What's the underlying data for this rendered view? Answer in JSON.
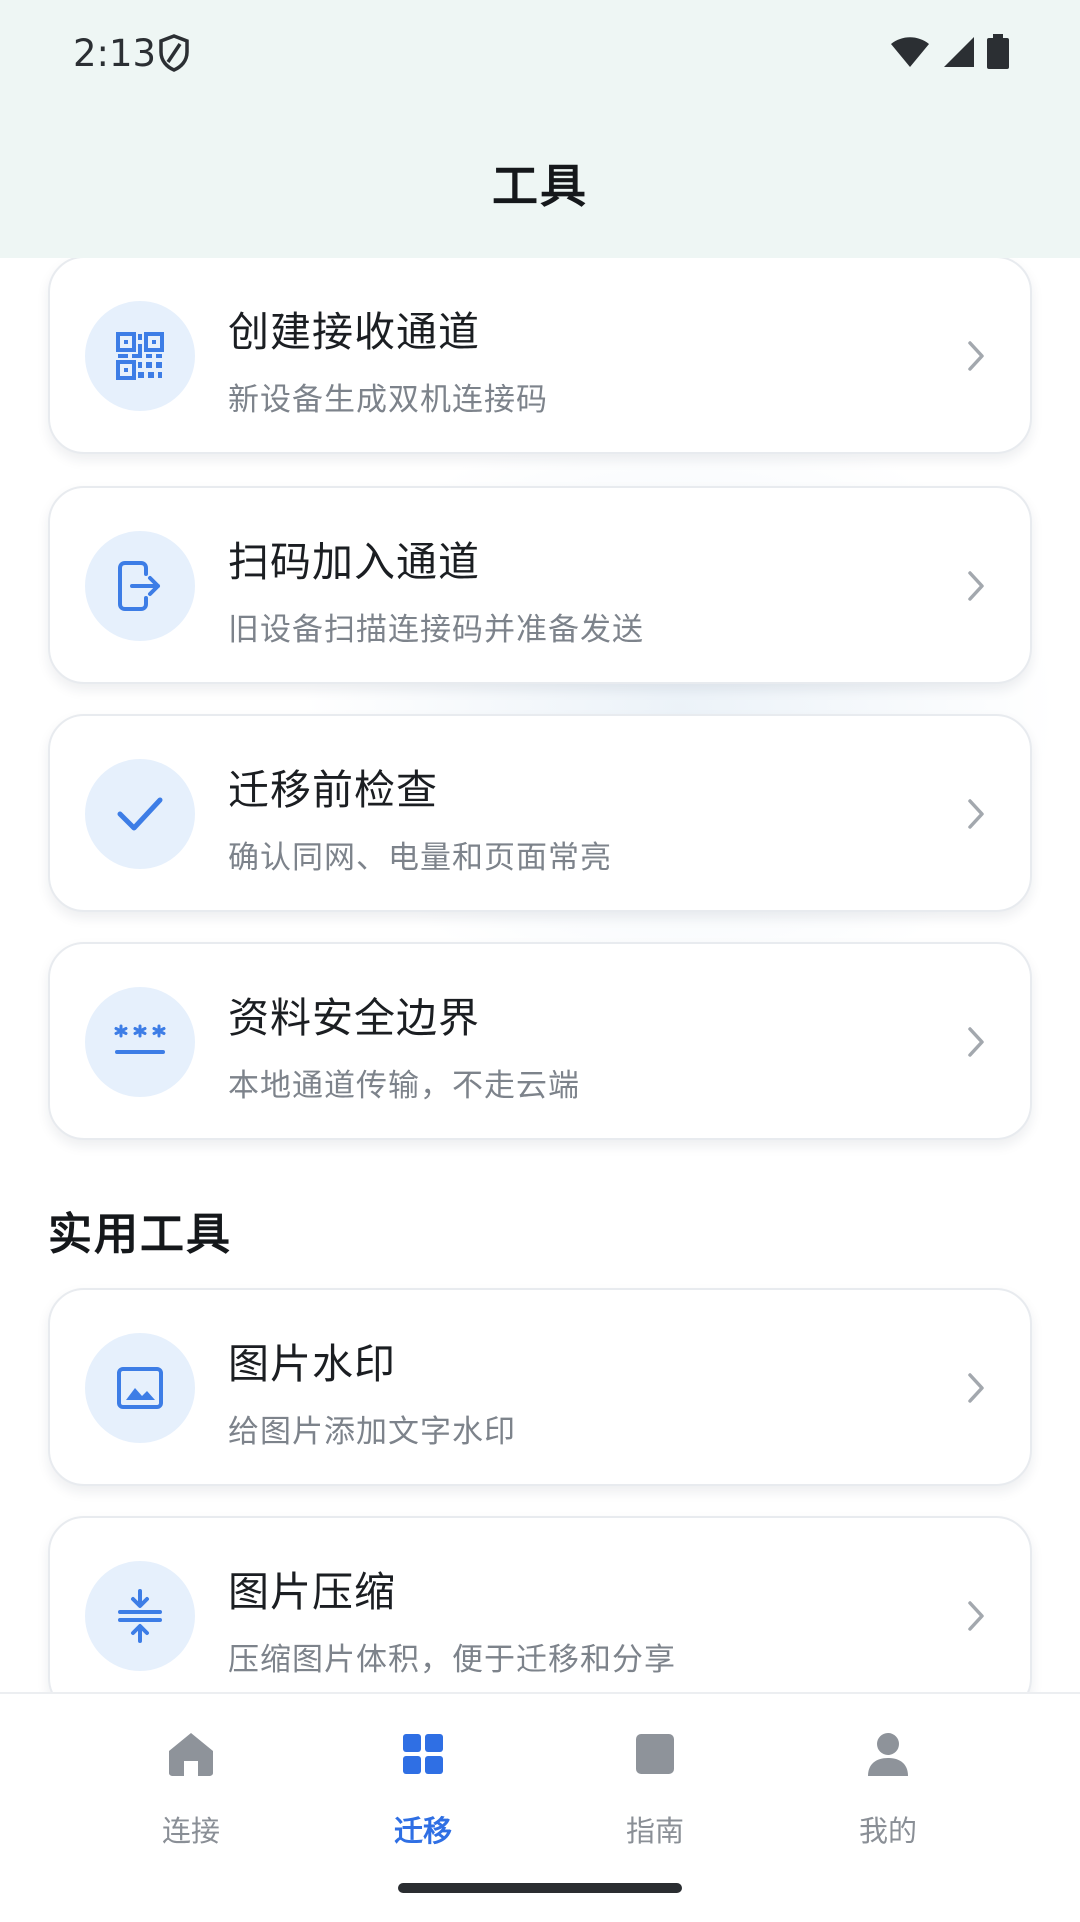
{
  "status": {
    "time": "2:13"
  },
  "header": {
    "title": "工具"
  },
  "cards": [
    {
      "title": "创建接收通道",
      "subtitle": "新设备生成双机连接码",
      "icon": "qr-code-icon"
    },
    {
      "title": "扫码加入通道",
      "subtitle": "旧设备扫描连接码并准备发送",
      "icon": "phone-exit-icon"
    },
    {
      "title": "迁移前检查",
      "subtitle": "确认同网、电量和页面常亮",
      "icon": "checkmark-icon"
    },
    {
      "title": "资料安全边界",
      "subtitle": "本地通道传输，不走云端",
      "icon": "password-icon"
    }
  ],
  "tools_section": {
    "title": "实用工具"
  },
  "tools": [
    {
      "title": "图片水印",
      "subtitle": "给图片添加文字水印",
      "icon": "image-icon"
    },
    {
      "title": "图片压缩",
      "subtitle": "压缩图片体积，便于迁移和分享",
      "icon": "compress-icon"
    }
  ],
  "nav": [
    {
      "label": "连接",
      "icon": "home-icon",
      "active": false
    },
    {
      "label": "迁移",
      "icon": "grid-icon",
      "active": true
    },
    {
      "label": "指南",
      "icon": "book-icon",
      "active": false
    },
    {
      "label": "我的",
      "icon": "person-icon",
      "active": false
    }
  ],
  "colors": {
    "accent": "#2f6fe4",
    "icon_bg": "#e6f0fc",
    "header_bg": "#eef6f4"
  }
}
